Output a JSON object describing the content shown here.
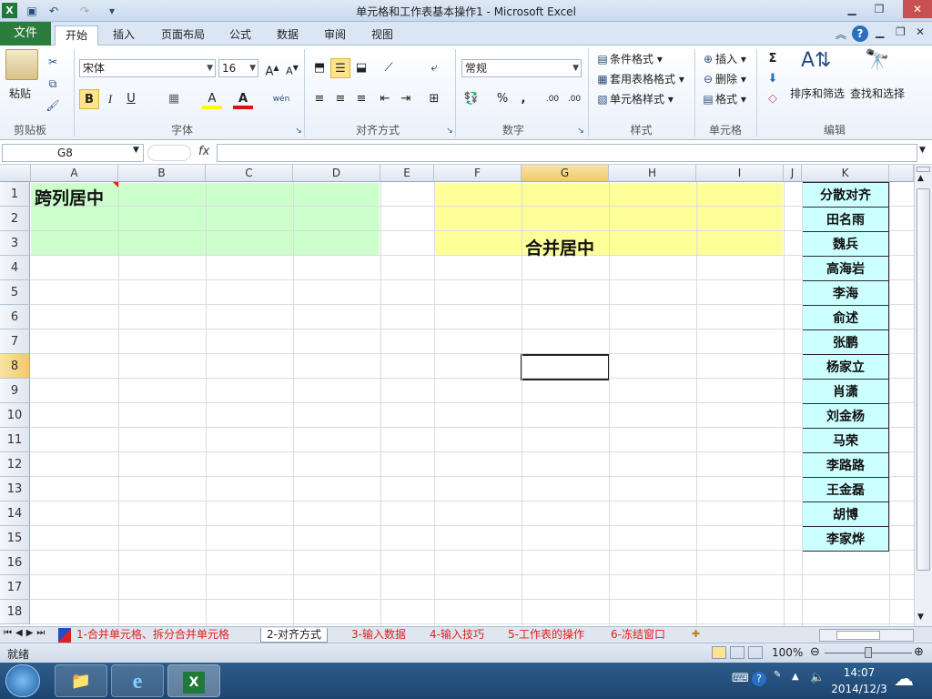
{
  "window": {
    "title": "单元格和工作表基本操作1 - Microsoft Excel",
    "app_icon": "X"
  },
  "tabs": [
    "文件",
    "开始",
    "插入",
    "页面布局",
    "公式",
    "数据",
    "审阅",
    "视图"
  ],
  "ribbon": {
    "clipboard": {
      "paste": "粘贴",
      "group": "剪贴板"
    },
    "font": {
      "name": "宋体",
      "size": "16",
      "bold": "B",
      "italic": "I",
      "underline": "U",
      "fill": "A",
      "color": "A",
      "wen": "wén",
      "group": "字体"
    },
    "alignment": {
      "group": "对齐方式"
    },
    "number": {
      "format": "常规",
      "percent": "%",
      "comma": ",",
      "inc_decimal": ".00",
      "dec_decimal": ".00",
      "group": "数字"
    },
    "styles": {
      "conditional": "条件格式",
      "table": "套用表格格式",
      "cell": "单元格样式",
      "group": "样式"
    },
    "cells": {
      "insert": "插入",
      "delete": "删除",
      "format": "格式",
      "group": "单元格"
    },
    "editing": {
      "sum": "Σ",
      "sort": "排序和筛选",
      "find": "查找和选择",
      "group": "编辑"
    }
  },
  "formula_bar": {
    "name_box": "G8",
    "fx": "fx",
    "value": ""
  },
  "columns": [
    "A",
    "B",
    "C",
    "D",
    "E",
    "F",
    "G",
    "H",
    "I",
    "J",
    "K"
  ],
  "rows": [
    "1",
    "2",
    "3",
    "4",
    "5",
    "6",
    "7",
    "8",
    "9",
    "10",
    "11",
    "12",
    "13",
    "14",
    "15",
    "16",
    "17",
    "18"
  ],
  "cells": {
    "a1": "跨列居中",
    "f1": "合并居中",
    "names": [
      "分散对齐",
      "田名雨",
      "魏兵",
      "高海岩",
      "李海",
      "俞述",
      "张鹏",
      "杨家立",
      "肖潇",
      "刘金杨",
      "马荣",
      "李路路",
      "王金磊",
      "胡博",
      "李家烨"
    ]
  },
  "sheets": [
    "1-合并单元格、拆分合并单元格",
    "2-对齐方式",
    "3-输入数据",
    "4-输入技巧",
    "5-工作表的操作",
    "6-冻结窗口"
  ],
  "status": {
    "ready": "就绪",
    "zoom": "100%"
  },
  "taskbar": {
    "time": "14:07",
    "date": "2014/12/3"
  },
  "colors": {
    "green_fill": "#ccffcc",
    "yellow_fill": "#ffff99",
    "cyan_fill": "#ccffff",
    "file_tab": "#2a7d3b"
  }
}
